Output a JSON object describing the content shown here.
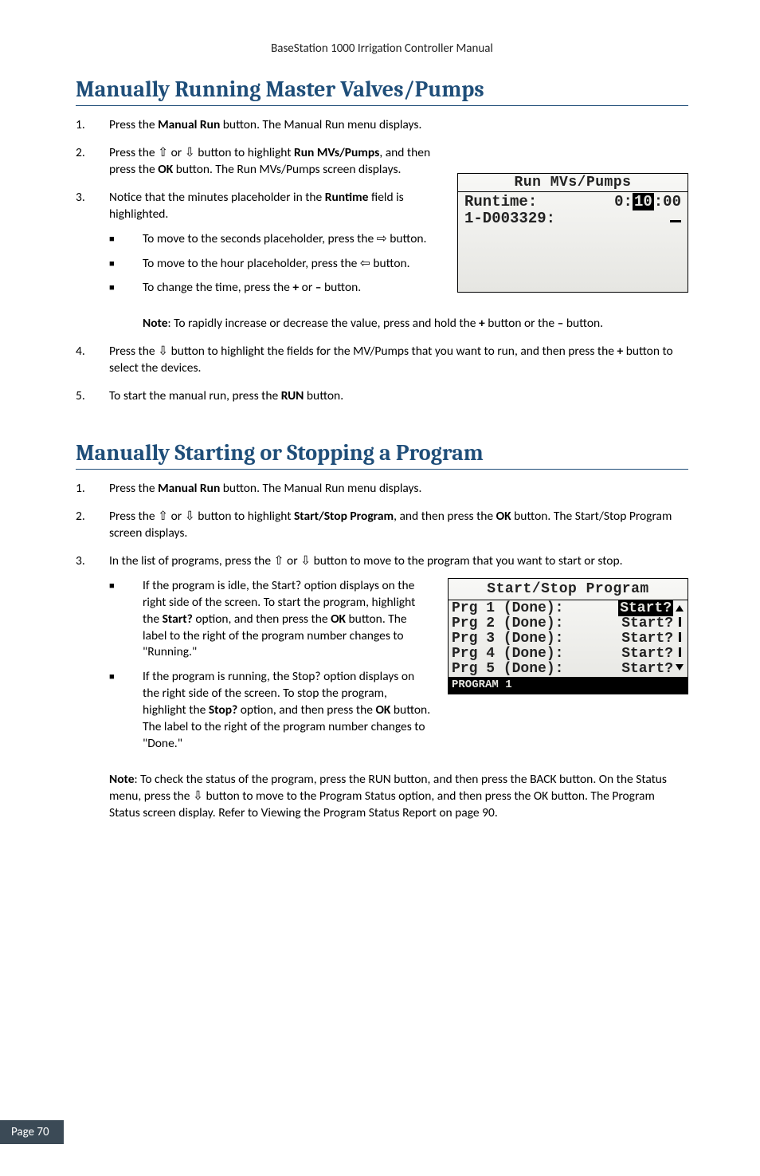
{
  "header": {
    "doc_title": "BaseStation 1000 Irrigation Controller Manual"
  },
  "footer": {
    "page_label": "Page 70"
  },
  "section1": {
    "heading": "Manually Running Master Valves/Pumps",
    "step1": {
      "num": "1.",
      "text_a": "Press the ",
      "bold_a": "Manual Run",
      "text_b": " button. The Manual Run menu displays."
    },
    "step2": {
      "num": "2.",
      "text_a": "Press the ",
      "arrow_up": "⇧",
      "text_b": " or ",
      "arrow_down": "⇩",
      "text_c": " button to highlight ",
      "bold_a": "Run MVs/Pumps",
      "text_d": ", and then press the ",
      "bold_b": "OK",
      "text_e": " button. The Run MVs/Pumps screen displays."
    },
    "step3": {
      "num": "3.",
      "text_a": "Notice that the minutes placeholder in the ",
      "bold_a": "Runtime",
      "text_b": " field is highlighted.",
      "sub1": {
        "text_a": "To move to the seconds placeholder, press the ",
        "arrow": "⇨",
        "text_b": " button."
      },
      "sub2": {
        "text_a": "To move to the hour placeholder, press the ",
        "arrow": "⇦",
        "text_b": " button."
      },
      "sub3": {
        "text_a": "To change the time, press the ",
        "plus": "+",
        "text_b": " or ",
        "minus": "–",
        "text_c": " button."
      }
    },
    "note1": {
      "label": "Note",
      "text_a": ": To rapidly increase or decrease the value, press and hold the ",
      "plus": "+",
      "text_b": " button or the ",
      "minus": "–",
      "text_c": " button."
    },
    "step4": {
      "num": "4.",
      "text_a": "Press the ",
      "arrow_down": "⇩",
      "text_b": " button to highlight the fields for the MV/Pumps that you want to run, and then press the ",
      "plus": "+",
      "text_c": " button to select the devices."
    },
    "step5": {
      "num": "5.",
      "text_a": "To start the manual run, press the ",
      "bold_a": "RUN",
      "text_b": " button."
    },
    "lcd": {
      "title": "Run MVs/Pumps",
      "row1_left": "Runtime:",
      "row1_h": "0:",
      "row1_m": "10",
      "row1_s": ":00",
      "row2_left": "1-D003329:"
    }
  },
  "section2": {
    "heading": "Manually Starting or Stopping a Program",
    "step1": {
      "num": "1.",
      "text_a": "Press the ",
      "bold_a": "Manual Run",
      "text_b": " button. The Manual Run menu displays."
    },
    "step2": {
      "num": "2.",
      "text_a": "Press the ",
      "arrow_up": "⇧",
      "text_b": " or ",
      "arrow_down": "⇩",
      "text_c": " button to highlight ",
      "bold_a": "Start/Stop Program",
      "text_d": ", and then press the ",
      "bold_b": "OK",
      "text_e": " button. The Start/Stop Program screen displays."
    },
    "step3": {
      "num": "3.",
      "text_a": "In the list of programs, press the ",
      "arrow_up": "⇧",
      "text_b": " or ",
      "arrow_down": "⇩",
      "text_c": " button to move to the program that you want to start or stop.",
      "sub1": {
        "text_a": "If the program is idle, the Start? option displays on the right side of the screen. To start the program, highlight the ",
        "bold_a": "Start?",
        "text_b": " option, and then press the ",
        "bold_b": "OK",
        "text_c": " button. The label to the right of the program number changes to \"Running.\""
      },
      "sub2": {
        "text_a": "If the program is running, the Stop? option displays on the right side of the screen. To stop the program, highlight the ",
        "bold_a": "Stop?",
        "text_b": " option, and then press the ",
        "bold_b": "OK",
        "text_c": " button. The label to the right of the program number changes to \"Done.\""
      }
    },
    "note1": {
      "label": "Note",
      "text_a": ": To check the status of the program, press the RUN button, and then press the BACK button. On the Status menu, press the ",
      "arrow_down": "⇩",
      "text_b": " button to move to the Program Status option, and then press the OK button. The Program Status screen display. Refer to Viewing the Program Status Report on page 90."
    },
    "lcd": {
      "title": "Start/Stop Program",
      "rows": [
        {
          "left": "Prg 1 (Done):",
          "right": "Start?"
        },
        {
          "left": "Prg 2 (Done):",
          "right": "Start?"
        },
        {
          "left": "Prg 3 (Done):",
          "right": "Start?"
        },
        {
          "left": "Prg 4 (Done):",
          "right": "Start?"
        },
        {
          "left": "Prg 5 (Done):",
          "right": "Start?"
        }
      ],
      "footer": "PROGRAM 1"
    }
  }
}
